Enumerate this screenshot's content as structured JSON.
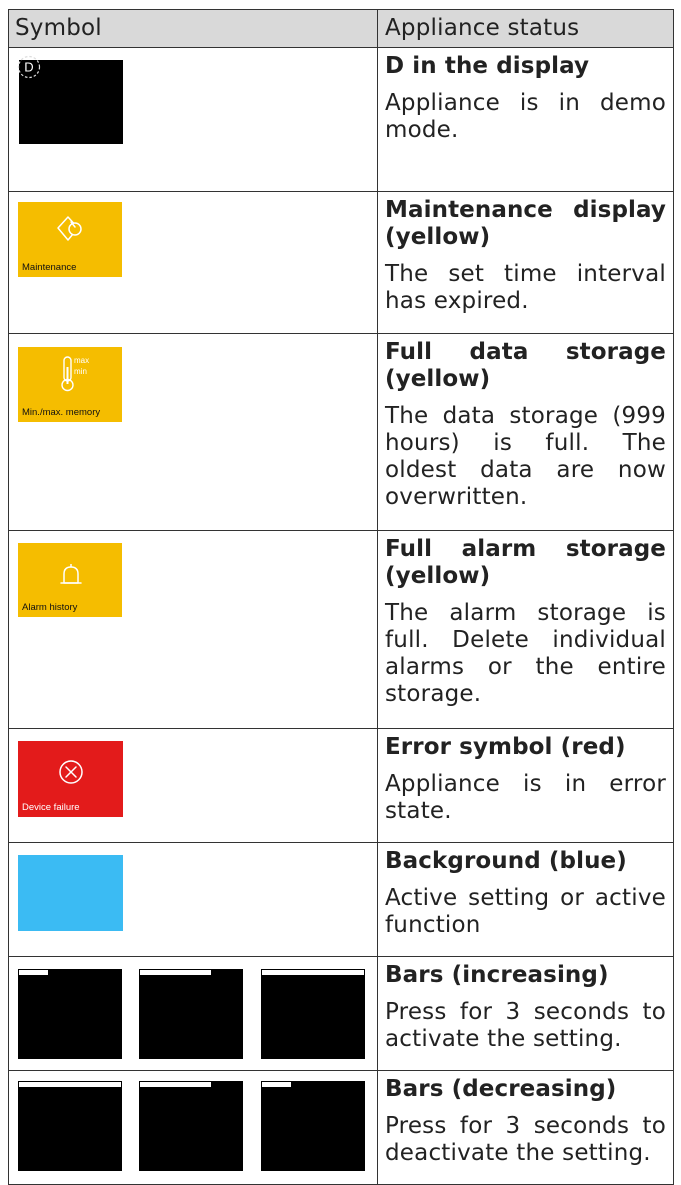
{
  "header": {
    "col_symbol": "Symbol",
    "col_status": "Appliance status"
  },
  "rows": [
    {
      "title": "D in the display",
      "desc": "Appliance is in demo mode.",
      "icon": "demo-d-icon",
      "panel_color": "#000000",
      "symbol_text": "D"
    },
    {
      "title": "Maintenance display (yellow)",
      "desc": "The set time interval has expired.",
      "icon": "maintenance-icon",
      "panel_color": "#f5bd00",
      "panel_label": "Maintenance"
    },
    {
      "title": "Full data storage (yellow)",
      "desc": "The data storage (999 hours) is full. The oldest data are now overwritten.",
      "icon": "thermometer-icon",
      "panel_color": "#f5bd00",
      "panel_label": "Min./max. memory",
      "icon_max": "max",
      "icon_min": "min"
    },
    {
      "title": "Full alarm storage (yellow)",
      "desc": "The alarm storage is full. Delete individual alarms or the entire storage.",
      "icon": "bell-icon",
      "panel_color": "#f5bd00",
      "panel_label": "Alarm history"
    },
    {
      "title": "Error symbol (red)",
      "desc": "Appliance is in error state.",
      "icon": "error-x-circle-icon",
      "panel_color": "#e31b1b",
      "panel_label": "Device failure"
    },
    {
      "title": "Background (blue)",
      "desc": "Active setting or active function",
      "panel_color": "#3bbbf3"
    },
    {
      "title": "Bars (increasing)",
      "desc": "Press for 3 seconds to activate the setting.",
      "panel_color": "#000000",
      "bar_levels": [
        0.3,
        0.7,
        1.0
      ]
    },
    {
      "title": "Bars (decreasing)",
      "desc": "Press for 3 seconds to deactivate the setting.",
      "panel_color": "#000000",
      "bar_levels": [
        1.0,
        0.7,
        0.3
      ]
    }
  ]
}
